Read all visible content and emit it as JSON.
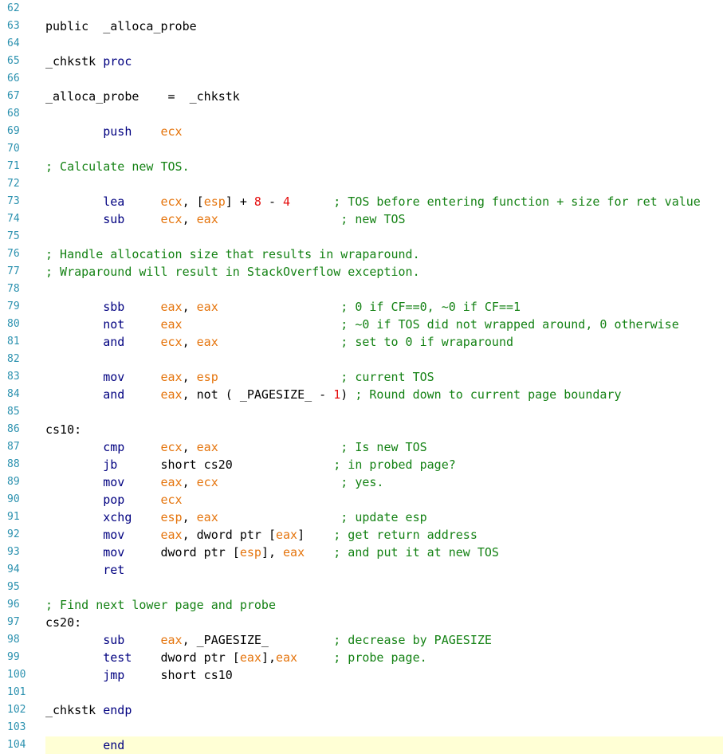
{
  "editor": {
    "lines": [
      {
        "n": "62",
        "tokens": []
      },
      {
        "n": "63",
        "tokens": [
          {
            "t": "public  _alloca_probe",
            "c": "plain"
          }
        ]
      },
      {
        "n": "64",
        "tokens": []
      },
      {
        "n": "65",
        "tokens": [
          {
            "t": "_chkstk ",
            "c": "plain"
          },
          {
            "t": "proc",
            "c": "kw"
          }
        ]
      },
      {
        "n": "66",
        "tokens": []
      },
      {
        "n": "67",
        "tokens": [
          {
            "t": "_alloca_probe    =  _chkstk",
            "c": "plain"
          }
        ]
      },
      {
        "n": "68",
        "tokens": []
      },
      {
        "n": "69",
        "tokens": [
          {
            "t": "        ",
            "c": "plain"
          },
          {
            "t": "push",
            "c": "kw"
          },
          {
            "t": "    ",
            "c": "plain"
          },
          {
            "t": "ecx",
            "c": "reg"
          }
        ]
      },
      {
        "n": "70",
        "tokens": []
      },
      {
        "n": "71",
        "tokens": [
          {
            "t": "; Calculate new TOS.",
            "c": "cmt"
          }
        ]
      },
      {
        "n": "72",
        "tokens": []
      },
      {
        "n": "73",
        "tokens": [
          {
            "t": "        ",
            "c": "plain"
          },
          {
            "t": "lea",
            "c": "kw"
          },
          {
            "t": "     ",
            "c": "plain"
          },
          {
            "t": "ecx",
            "c": "reg"
          },
          {
            "t": ", [",
            "c": "plain"
          },
          {
            "t": "esp",
            "c": "reg"
          },
          {
            "t": "] + ",
            "c": "plain"
          },
          {
            "t": "8",
            "c": "num"
          },
          {
            "t": " - ",
            "c": "plain"
          },
          {
            "t": "4",
            "c": "num"
          },
          {
            "t": "      ",
            "c": "plain"
          },
          {
            "t": "; TOS before entering function + size for ret value",
            "c": "cmt"
          }
        ]
      },
      {
        "n": "74",
        "tokens": [
          {
            "t": "        ",
            "c": "plain"
          },
          {
            "t": "sub",
            "c": "kw"
          },
          {
            "t": "     ",
            "c": "plain"
          },
          {
            "t": "ecx",
            "c": "reg"
          },
          {
            "t": ", ",
            "c": "plain"
          },
          {
            "t": "eax",
            "c": "reg"
          },
          {
            "t": "                 ",
            "c": "plain"
          },
          {
            "t": "; new TOS",
            "c": "cmt"
          }
        ]
      },
      {
        "n": "75",
        "tokens": []
      },
      {
        "n": "76",
        "tokens": [
          {
            "t": "; Handle allocation size that results in wraparound.",
            "c": "cmt"
          }
        ]
      },
      {
        "n": "77",
        "tokens": [
          {
            "t": "; Wraparound will result in StackOverflow exception.",
            "c": "cmt"
          }
        ]
      },
      {
        "n": "78",
        "tokens": []
      },
      {
        "n": "79",
        "tokens": [
          {
            "t": "        ",
            "c": "plain"
          },
          {
            "t": "sbb",
            "c": "kw"
          },
          {
            "t": "     ",
            "c": "plain"
          },
          {
            "t": "eax",
            "c": "reg"
          },
          {
            "t": ", ",
            "c": "plain"
          },
          {
            "t": "eax",
            "c": "reg"
          },
          {
            "t": "                 ",
            "c": "plain"
          },
          {
            "t": "; 0 if CF==0, ~0 if CF==1",
            "c": "cmt"
          }
        ]
      },
      {
        "n": "80",
        "tokens": [
          {
            "t": "        ",
            "c": "plain"
          },
          {
            "t": "not",
            "c": "kw"
          },
          {
            "t": "     ",
            "c": "plain"
          },
          {
            "t": "eax",
            "c": "reg"
          },
          {
            "t": "                      ",
            "c": "plain"
          },
          {
            "t": "; ~0 if TOS did not wrapped around, 0 otherwise",
            "c": "cmt"
          }
        ]
      },
      {
        "n": "81",
        "tokens": [
          {
            "t": "        ",
            "c": "plain"
          },
          {
            "t": "and",
            "c": "kw"
          },
          {
            "t": "     ",
            "c": "plain"
          },
          {
            "t": "ecx",
            "c": "reg"
          },
          {
            "t": ", ",
            "c": "plain"
          },
          {
            "t": "eax",
            "c": "reg"
          },
          {
            "t": "                 ",
            "c": "plain"
          },
          {
            "t": "; set to 0 if wraparound",
            "c": "cmt"
          }
        ]
      },
      {
        "n": "82",
        "tokens": []
      },
      {
        "n": "83",
        "tokens": [
          {
            "t": "        ",
            "c": "plain"
          },
          {
            "t": "mov",
            "c": "kw"
          },
          {
            "t": "     ",
            "c": "plain"
          },
          {
            "t": "eax",
            "c": "reg"
          },
          {
            "t": ", ",
            "c": "plain"
          },
          {
            "t": "esp",
            "c": "reg"
          },
          {
            "t": "                 ",
            "c": "plain"
          },
          {
            "t": "; current TOS",
            "c": "cmt"
          }
        ]
      },
      {
        "n": "84",
        "tokens": [
          {
            "t": "        ",
            "c": "plain"
          },
          {
            "t": "and",
            "c": "kw"
          },
          {
            "t": "     ",
            "c": "plain"
          },
          {
            "t": "eax",
            "c": "reg"
          },
          {
            "t": ", not ( _PAGESIZE_ - ",
            "c": "plain"
          },
          {
            "t": "1",
            "c": "num"
          },
          {
            "t": ") ",
            "c": "plain"
          },
          {
            "t": "; Round down to current page boundary",
            "c": "cmt"
          }
        ]
      },
      {
        "n": "85",
        "tokens": []
      },
      {
        "n": "86",
        "tokens": [
          {
            "t": "cs10:",
            "c": "plain"
          }
        ]
      },
      {
        "n": "87",
        "tokens": [
          {
            "t": "        ",
            "c": "plain"
          },
          {
            "t": "cmp",
            "c": "kw"
          },
          {
            "t": "     ",
            "c": "plain"
          },
          {
            "t": "ecx",
            "c": "reg"
          },
          {
            "t": ", ",
            "c": "plain"
          },
          {
            "t": "eax",
            "c": "reg"
          },
          {
            "t": "                 ",
            "c": "plain"
          },
          {
            "t": "; Is new TOS",
            "c": "cmt"
          }
        ]
      },
      {
        "n": "88",
        "tokens": [
          {
            "t": "        ",
            "c": "plain"
          },
          {
            "t": "jb",
            "c": "kw"
          },
          {
            "t": "      short cs20",
            "c": "plain"
          },
          {
            "t": "              ",
            "c": "plain"
          },
          {
            "t": "; in probed page?",
            "c": "cmt"
          }
        ]
      },
      {
        "n": "89",
        "tokens": [
          {
            "t": "        ",
            "c": "plain"
          },
          {
            "t": "mov",
            "c": "kw"
          },
          {
            "t": "     ",
            "c": "plain"
          },
          {
            "t": "eax",
            "c": "reg"
          },
          {
            "t": ", ",
            "c": "plain"
          },
          {
            "t": "ecx",
            "c": "reg"
          },
          {
            "t": "                 ",
            "c": "plain"
          },
          {
            "t": "; yes.",
            "c": "cmt"
          }
        ]
      },
      {
        "n": "90",
        "tokens": [
          {
            "t": "        ",
            "c": "plain"
          },
          {
            "t": "pop",
            "c": "kw"
          },
          {
            "t": "     ",
            "c": "plain"
          },
          {
            "t": "ecx",
            "c": "reg"
          }
        ]
      },
      {
        "n": "91",
        "tokens": [
          {
            "t": "        ",
            "c": "plain"
          },
          {
            "t": "xchg",
            "c": "kw"
          },
          {
            "t": "    ",
            "c": "plain"
          },
          {
            "t": "esp",
            "c": "reg"
          },
          {
            "t": ", ",
            "c": "plain"
          },
          {
            "t": "eax",
            "c": "reg"
          },
          {
            "t": "                 ",
            "c": "plain"
          },
          {
            "t": "; update esp",
            "c": "cmt"
          }
        ]
      },
      {
        "n": "92",
        "tokens": [
          {
            "t": "        ",
            "c": "plain"
          },
          {
            "t": "mov",
            "c": "kw"
          },
          {
            "t": "     ",
            "c": "plain"
          },
          {
            "t": "eax",
            "c": "reg"
          },
          {
            "t": ", dword ptr [",
            "c": "plain"
          },
          {
            "t": "eax",
            "c": "reg"
          },
          {
            "t": "]    ",
            "c": "plain"
          },
          {
            "t": "; get return address",
            "c": "cmt"
          }
        ]
      },
      {
        "n": "93",
        "tokens": [
          {
            "t": "        ",
            "c": "plain"
          },
          {
            "t": "mov",
            "c": "kw"
          },
          {
            "t": "     dword ptr [",
            "c": "plain"
          },
          {
            "t": "esp",
            "c": "reg"
          },
          {
            "t": "], ",
            "c": "plain"
          },
          {
            "t": "eax",
            "c": "reg"
          },
          {
            "t": "    ",
            "c": "plain"
          },
          {
            "t": "; and put it at new TOS",
            "c": "cmt"
          }
        ]
      },
      {
        "n": "94",
        "tokens": [
          {
            "t": "        ",
            "c": "plain"
          },
          {
            "t": "ret",
            "c": "kw"
          }
        ]
      },
      {
        "n": "95",
        "tokens": []
      },
      {
        "n": "96",
        "tokens": [
          {
            "t": "; Find next lower page and probe",
            "c": "cmt"
          }
        ]
      },
      {
        "n": "97",
        "tokens": [
          {
            "t": "cs20:",
            "c": "plain"
          }
        ]
      },
      {
        "n": "98",
        "tokens": [
          {
            "t": "        ",
            "c": "plain"
          },
          {
            "t": "sub",
            "c": "kw"
          },
          {
            "t": "     ",
            "c": "plain"
          },
          {
            "t": "eax",
            "c": "reg"
          },
          {
            "t": ", _PAGESIZE_",
            "c": "plain"
          },
          {
            "t": "         ",
            "c": "plain"
          },
          {
            "t": "; decrease by PAGESIZE",
            "c": "cmt"
          }
        ]
      },
      {
        "n": "99",
        "tokens": [
          {
            "t": "        ",
            "c": "plain"
          },
          {
            "t": "test",
            "c": "kw"
          },
          {
            "t": "    dword ptr [",
            "c": "plain"
          },
          {
            "t": "eax",
            "c": "reg"
          },
          {
            "t": "],",
            "c": "plain"
          },
          {
            "t": "eax",
            "c": "reg"
          },
          {
            "t": "     ",
            "c": "plain"
          },
          {
            "t": "; probe page.",
            "c": "cmt"
          }
        ]
      },
      {
        "n": "100",
        "tokens": [
          {
            "t": "        ",
            "c": "plain"
          },
          {
            "t": "jmp",
            "c": "kw"
          },
          {
            "t": "     short cs10",
            "c": "plain"
          }
        ]
      },
      {
        "n": "101",
        "tokens": []
      },
      {
        "n": "102",
        "tokens": [
          {
            "t": "_chkstk ",
            "c": "plain"
          },
          {
            "t": "endp",
            "c": "kw"
          }
        ]
      },
      {
        "n": "103",
        "tokens": []
      },
      {
        "n": "104",
        "tokens": [
          {
            "t": "        ",
            "c": "plain"
          },
          {
            "t": "end",
            "c": "kw"
          }
        ],
        "current": true
      }
    ]
  },
  "colors": {
    "line_number": "#2b91af",
    "keyword": "#000080",
    "register": "#e5740c",
    "number": "#e50c0c",
    "comment": "#148214",
    "current_line_highlight": "#ffffd5"
  }
}
